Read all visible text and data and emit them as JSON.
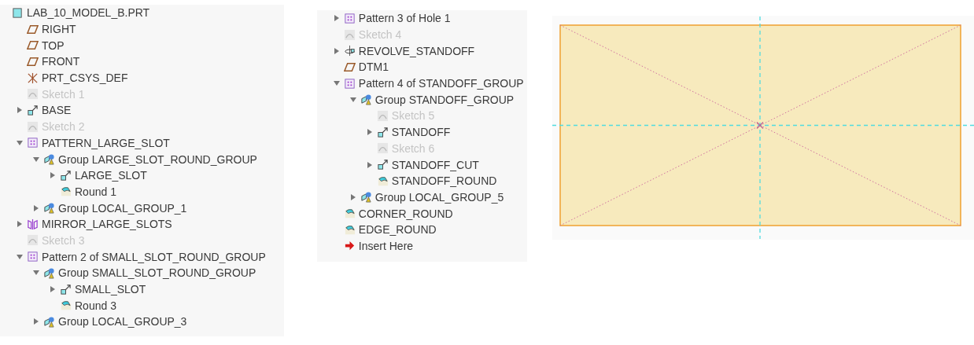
{
  "model_tree": {
    "columns": [
      {
        "items": [
          {
            "label": "LAB_10_MODEL_B.PRT",
            "kind": "part",
            "children": [
              {
                "label": "RIGHT",
                "kind": "datum"
              },
              {
                "label": "TOP",
                "kind": "datum"
              },
              {
                "label": "FRONT",
                "kind": "datum"
              },
              {
                "label": "PRT_CSYS_DEF",
                "kind": "csys"
              },
              {
                "label": "Sketch 1",
                "kind": "sketch"
              },
              {
                "label": "BASE",
                "kind": "extrude",
                "expanded": false
              },
              {
                "label": "Sketch 2",
                "kind": "sketch"
              },
              {
                "label": "PATTERN_LARGE_SLOT",
                "kind": "pattern",
                "expanded": true,
                "children": [
                  {
                    "label": "Group LARGE_SLOT_ROUND_GROUP",
                    "kind": "group",
                    "expanded": true,
                    "children": [
                      {
                        "label": "LARGE_SLOT",
                        "kind": "extrude",
                        "expanded": false
                      },
                      {
                        "label": "Round 1",
                        "kind": "round"
                      }
                    ]
                  },
                  {
                    "label": "Group LOCAL_GROUP_1",
                    "kind": "group",
                    "expanded": false
                  }
                ]
              },
              {
                "label": "MIRROR_LARGE_SLOTS",
                "kind": "mirror",
                "expanded": false
              },
              {
                "label": "Sketch 3",
                "kind": "sketch"
              },
              {
                "label": "Pattern 2 of SMALL_SLOT_ROUND_GROUP",
                "kind": "pattern",
                "expanded": true,
                "children": [
                  {
                    "label": "Group SMALL_SLOT_ROUND_GROUP",
                    "kind": "group",
                    "expanded": true,
                    "children": [
                      {
                        "label": "SMALL_SLOT",
                        "kind": "extrude",
                        "expanded": false
                      },
                      {
                        "label": "Round 3",
                        "kind": "round"
                      }
                    ]
                  },
                  {
                    "label": "Group LOCAL_GROUP_3",
                    "kind": "group",
                    "expanded": false
                  }
                ]
              }
            ]
          }
        ]
      },
      {
        "items": [
          {
            "label": "Pattern 3 of Hole 1",
            "kind": "pattern",
            "expanded": false
          },
          {
            "label": "Sketch 4",
            "kind": "sketch"
          },
          {
            "label": "REVOLVE_STANDOFF",
            "kind": "revolve",
            "expanded": false
          },
          {
            "label": "DTM1",
            "kind": "datum"
          },
          {
            "label": "Pattern 4 of STANDOFF_GROUP",
            "kind": "pattern",
            "expanded": true,
            "children": [
              {
                "label": "Group STANDOFF_GROUP",
                "kind": "group",
                "expanded": true,
                "children": [
                  {
                    "label": "Sketch 5",
                    "kind": "sketch"
                  },
                  {
                    "label": "STANDOFF",
                    "kind": "extrude",
                    "expanded": false
                  },
                  {
                    "label": "Sketch 6",
                    "kind": "sketch"
                  },
                  {
                    "label": "STANDOFF_CUT",
                    "kind": "extrude",
                    "expanded": false
                  },
                  {
                    "label": "STANDOFF_ROUND",
                    "kind": "round"
                  }
                ]
              },
              {
                "label": "Group LOCAL_GROUP_5",
                "kind": "group",
                "expanded": false
              }
            ]
          },
          {
            "label": "CORNER_ROUND",
            "kind": "round"
          },
          {
            "label": "EDGE_ROUND",
            "kind": "round"
          },
          {
            "label": "Insert Here",
            "kind": "insert"
          }
        ]
      }
    ]
  },
  "viewport": {
    "kind": "sketch"
  }
}
